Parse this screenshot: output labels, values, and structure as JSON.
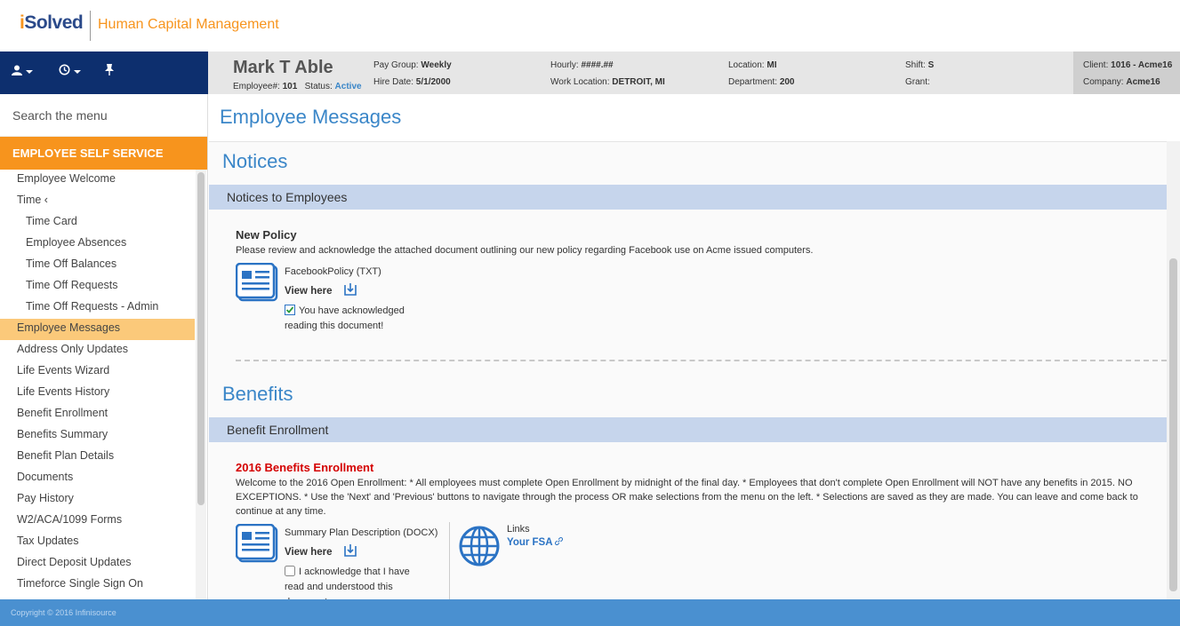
{
  "brand": {
    "logo_i": "i",
    "logo_rest": "Solved",
    "app_title": "Human Capital Management"
  },
  "nav_icons": [
    "user-icon",
    "history-icon",
    "pin-icon"
  ],
  "employee": {
    "name": "Mark T Able",
    "employee_num_label": "Employee#:",
    "employee_num": "101",
    "status_label": "Status:",
    "status": "Active",
    "pay_group_label": "Pay Group:",
    "pay_group": "Weekly",
    "hire_date_label": "Hire Date:",
    "hire_date": "5/1/2000",
    "hourly_label": "Hourly:",
    "hourly": "####.##",
    "work_location_label": "Work Location:",
    "work_location": "DETROIT, MI",
    "location_label": "Location:",
    "location": "MI",
    "department_label": "Department:",
    "department": "200",
    "shift_label": "Shift:",
    "shift": "S",
    "grant_label": "Grant:",
    "grant": "",
    "client_label": "Client:",
    "client": "1016 - Acme16",
    "company_label": "Company:",
    "company": "Acme16"
  },
  "sidebar": {
    "search_placeholder": "Search the menu",
    "section": "EMPLOYEE SELF SERVICE",
    "items": [
      {
        "label": "Employee Welcome",
        "sub": false
      },
      {
        "label": "Time  ‹",
        "sub": false
      },
      {
        "label": "Time Card",
        "sub": true
      },
      {
        "label": "Employee Absences",
        "sub": true
      },
      {
        "label": "Time Off Balances",
        "sub": true
      },
      {
        "label": "Time Off Requests",
        "sub": true
      },
      {
        "label": "Time Off Requests - Admin",
        "sub": true
      },
      {
        "label": "Employee Messages",
        "sub": false,
        "active": true
      },
      {
        "label": "Address Only Updates",
        "sub": false
      },
      {
        "label": "Life Events Wizard",
        "sub": false
      },
      {
        "label": "Life Events History",
        "sub": false
      },
      {
        "label": "Benefit Enrollment",
        "sub": false
      },
      {
        "label": "Benefits Summary",
        "sub": false
      },
      {
        "label": "Benefit Plan Details",
        "sub": false
      },
      {
        "label": "Documents",
        "sub": false
      },
      {
        "label": "Pay History",
        "sub": false
      },
      {
        "label": "W2/ACA/1099 Forms",
        "sub": false
      },
      {
        "label": "Tax Updates",
        "sub": false
      },
      {
        "label": "Direct Deposit Updates",
        "sub": false
      },
      {
        "label": "Timeforce Single Sign On",
        "sub": false
      }
    ]
  },
  "main": {
    "page_title": "Employee Messages",
    "notices": {
      "heading": "Notices",
      "band": "Notices to Employees",
      "item_title": "New Policy",
      "item_desc": "Please review and acknowledge the attached document outlining our new policy regarding Facebook use on Acme issued computers.",
      "doc_label": "FacebookPolicy (TXT)",
      "view_here": "View here",
      "ack_text": "You have acknowledged reading this document!"
    },
    "benefits": {
      "heading": "Benefits",
      "band": "Benefit Enrollment",
      "item_title": "2016 Benefits Enrollment",
      "item_desc": "Welcome to the 2016 Open Enrollment: * All employees must complete Open Enrollment by midnight of the final day. * Employees that don't complete Open Enrollment will NOT have any benefits in 2015. NO EXCEPTIONS. * Use the 'Next' and 'Previous' buttons to navigate through the process OR make selections from the menu on the left. * Selections are saved as they are made. You can leave and come back to continue at any time.",
      "doc_label": "Summary Plan Description (DOCX)",
      "view_here": "View here",
      "ack_text": "I acknowledge that I have read and understood this document",
      "links_label": "Links",
      "fsa_link": "Your FSA"
    }
  },
  "footer": {
    "copyright": "Copyright © 2016 Infinisource"
  },
  "colors": {
    "navy": "#0d2f6e",
    "orange": "#f7941d",
    "accent_blue": "#3a86c8",
    "band_blue": "#c6d5ec",
    "active_item": "#fbc97a",
    "enrollment_red": "#d40000"
  }
}
